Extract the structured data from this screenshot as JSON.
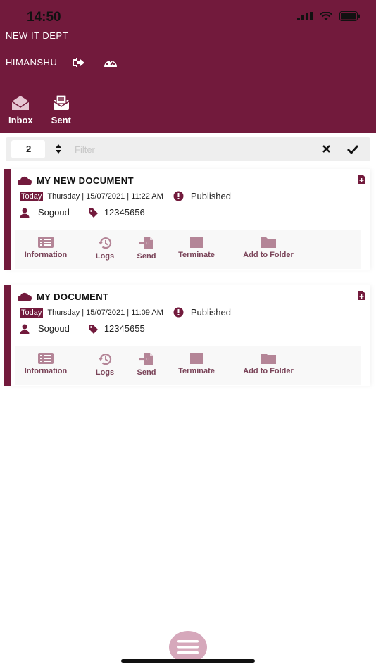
{
  "status_bar": {
    "time": "14:50"
  },
  "header": {
    "department": "NEW IT DEPT",
    "user": "HIMANSHU",
    "tabs": [
      {
        "label": "Inbox",
        "icon": "envelope-open-icon"
      },
      {
        "label": "Sent",
        "icon": "sent-envelope-icon"
      }
    ]
  },
  "filter": {
    "page_size": "2",
    "placeholder": "Filter",
    "value": ""
  },
  "documents": [
    {
      "title": "MY NEW DOCUMENT",
      "today_label": "Today",
      "date": "Thursday | 15/07/2021 | 11:22 AM",
      "status": "Published",
      "owner": "Sogoud",
      "reference": "12345656"
    },
    {
      "title": "MY DOCUMENT",
      "today_label": "Today",
      "date": "Thursday | 15/07/2021 | 11:09 AM",
      "status": "Published",
      "owner": "Sogoud",
      "reference": "12345655"
    }
  ],
  "actions": {
    "information": "Information",
    "logs": "Logs",
    "send": "Send",
    "terminate": "Terminate",
    "add_to_folder": "Add to Folder"
  },
  "colors": {
    "brand": "#721a3c",
    "action_text": "#7a4459",
    "action_icon": "#b48597",
    "fab": "#d6a8bb"
  }
}
